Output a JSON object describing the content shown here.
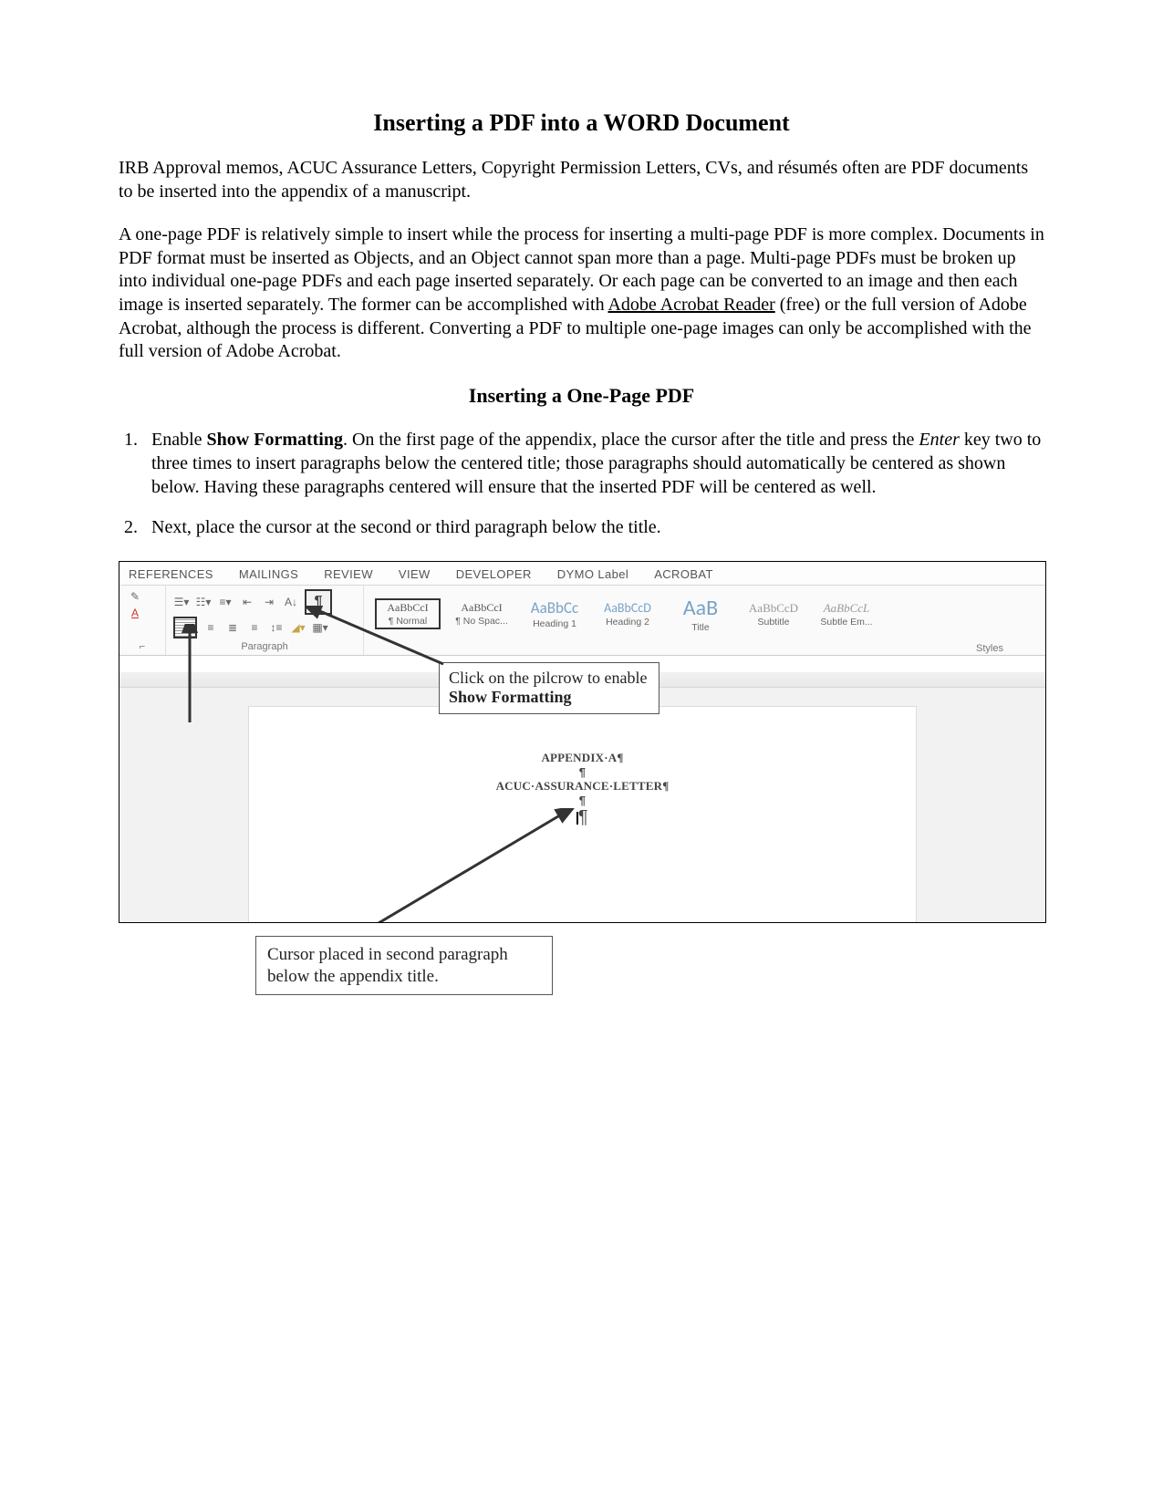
{
  "title": "Inserting a PDF into a WORD Document",
  "intro1": "IRB Approval memos, ACUC Assurance Letters, Copyright Permission Letters, CVs, and résumés often are PDF documents to be inserted into the appendix of a manuscript.",
  "intro2a": "A one-page PDF is relatively simple to insert while the process for inserting a multi-page PDF is more complex. Documents in PDF format must be inserted as Objects, and an Object cannot span more than a page. Multi-page PDFs must be broken up into individual one-page PDFs and each page inserted separately. Or each page can be converted to an image and then each image is inserted separately. The former can be accomplished with ",
  "adobe_link": "Adobe Acrobat Reader",
  "intro2b": " (free) or the full version of Adobe Acrobat, although the process is different. Converting a PDF to multiple one-page images can only be accomplished with the full version of Adobe Acrobat.",
  "subhead": "Inserting a One-Page PDF",
  "step1a": "Enable ",
  "step1_bold": "Show Formatting",
  "step1b": ". On the first page of the appendix, place the cursor after the title and press the ",
  "step1_enter": "Enter",
  "step1c": " key two to three times to insert paragraphs below the centered title; those paragraphs should automatically be centered as shown below. Having these paragraphs centered will ensure that the inserted PDF will be centered as well.",
  "step2": "Next, place the cursor at the second or third paragraph below the title.",
  "ribbon": {
    "tabs": [
      "REFERENCES",
      "MAILINGS",
      "REVIEW",
      "VIEW",
      "DEVELOPER",
      "DYMO Label",
      "ACROBAT"
    ],
    "para_group_label": "Paragraph",
    "styles_label": "Styles",
    "styles": [
      {
        "sample": "AaBbCcI",
        "name": "¶ Normal",
        "variant": "sel"
      },
      {
        "sample": "AaBbCcI",
        "name": "¶ No Spac..."
      },
      {
        "sample": "AaBbCc",
        "name": "Heading 1",
        "variant": "h1s"
      },
      {
        "sample": "AaBbCcD",
        "name": "Heading 2",
        "variant": "h2s"
      },
      {
        "sample": "AaB",
        "name": "Title",
        "variant": "big"
      },
      {
        "sample": "AaBbCcD",
        "name": "Subtitle",
        "variant": "sub"
      },
      {
        "sample": "AaBbCcL",
        "name": "Subtle Em...",
        "variant": "emph"
      }
    ]
  },
  "doc": {
    "line1": "APPENDIX·A¶",
    "line2": "¶",
    "line3": "ACUC·ASSURANCE·LETTER¶",
    "line4": "¶"
  },
  "callout1a": "Click on the pilcrow to enable ",
  "callout1b": "Show Formatting",
  "callout2": "Cursor placed in second paragraph below the appendix title."
}
